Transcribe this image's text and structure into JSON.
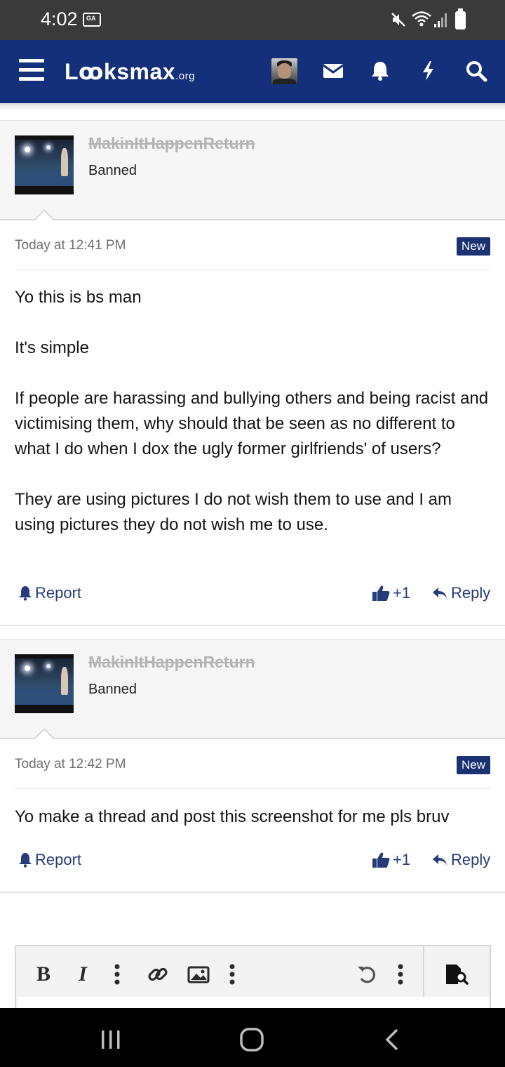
{
  "status_bar": {
    "time": "4:02",
    "gallery_icon_label": "GA"
  },
  "header": {
    "logo_main": "Lꝏksmax",
    "logo_suffix": ".org",
    "icons": [
      "menu-icon",
      "avatar",
      "mail-icon",
      "bell-icon",
      "bolt-icon",
      "search-icon"
    ]
  },
  "posts": [
    {
      "username": "MakinItHappenReturn",
      "role": "Banned",
      "date": "Today at 12:41 PM",
      "badge": "New",
      "paragraphs": [
        "Yo this is bs man",
        "It's simple",
        "If people are harassing and bullying others and being racist and victimising them, why should that be seen as no different to what I do when I dox the ugly former girlfriends' of users?",
        "They are using pictures I do not wish them to use and I am using pictures they do not wish me to use."
      ],
      "report_label": "Report",
      "like_label": "+1",
      "reply_label": "Reply"
    },
    {
      "username": "MakinItHappenReturn",
      "role": "Banned",
      "date": "Today at 12:42 PM",
      "badge": "New",
      "paragraphs": [
        "Yo make a thread and post this screenshot for me pls bruv"
      ],
      "report_label": "Report",
      "like_label": "+1",
      "reply_label": "Reply"
    }
  ],
  "editor": {
    "bold_label": "B",
    "italic_label": "I",
    "tools": [
      "bold",
      "italic",
      "more",
      "link",
      "image",
      "more",
      "undo",
      "more",
      "preview"
    ]
  },
  "colors": {
    "header_bg": "#14307a",
    "badge_bg": "#1b3272",
    "link": "#253c78",
    "status_bar_bg": "#3a3a3a"
  }
}
